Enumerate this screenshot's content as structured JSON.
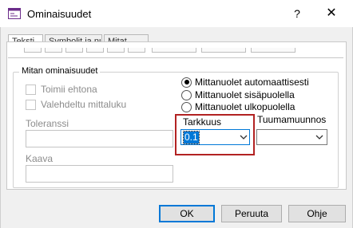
{
  "window": {
    "title": "Ominaisuudet"
  },
  "titlebar": {
    "help_label": "?",
    "close_label": "✕"
  },
  "tabs": [
    {
      "label": "Teksti"
    },
    {
      "label": "Symbolit ja nuolet"
    },
    {
      "label": "Mitat"
    }
  ],
  "group": {
    "title": "Mitan ominaisuudet",
    "checkboxes": [
      {
        "label": "Toimii ehtona",
        "checked": false,
        "enabled": false
      },
      {
        "label": "Valehdeltu mittaluku",
        "checked": false,
        "enabled": false
      }
    ],
    "radios": [
      {
        "label": "Mittanuolet automaattisesti",
        "checked": true
      },
      {
        "label": "Mittanuolet sisäpuolella",
        "checked": false
      },
      {
        "label": "Mittanuolet ulkopuolella",
        "checked": false
      }
    ],
    "tolerance": {
      "label": "Toleranssi",
      "value": ""
    },
    "formula": {
      "label": "Kaava",
      "value": ""
    },
    "precision": {
      "label": "Tarkkuus",
      "value": "0.1"
    },
    "inch_conversion": {
      "label": "Tuumamuunnos",
      "value": ""
    }
  },
  "buttons": {
    "ok": "OK",
    "cancel": "Peruuta",
    "help": "Ohje"
  },
  "colors": {
    "accent": "#0078d7",
    "highlight": "#b22222",
    "dialog_bg": "#f0f0f0"
  },
  "icons": {
    "app": "properties-icon",
    "close": "close-icon",
    "dropdown": "chevron-down-icon"
  }
}
